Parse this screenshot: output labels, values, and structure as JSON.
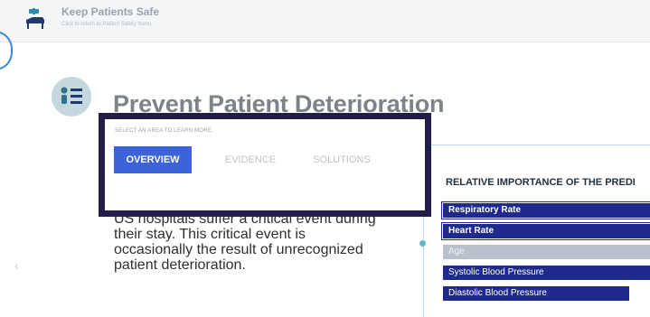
{
  "header": {
    "title": "Keep Patients Safe",
    "subtitle": "Click to return to Patient Safety menu."
  },
  "page": {
    "title": "Prevent Patient Deterioration",
    "body_text": "As many as 17% of patients admitted to US hospitals suffer a critical event during their stay. This critical event is occasionally the result of unrecognized patient deterioration."
  },
  "tabs": {
    "instruction": "SELECT AN AREA TO LEARN MORE.",
    "items": [
      {
        "label": "OVERVIEW",
        "active": true
      },
      {
        "label": "EVIDENCE",
        "active": false
      },
      {
        "label": "SOLUTIONS",
        "active": false
      }
    ]
  },
  "chart_data": {
    "type": "bar",
    "title": "RELATIVE IMPORTANCE OF THE PREDI",
    "categories": [
      "Respiratory Rate",
      "Heart Rate",
      "Age",
      "Systolic Blood Pressure",
      "Diastolic Blood Pressure"
    ],
    "values": [
      1.0,
      1.0,
      1.0,
      1.0,
      0.9
    ]
  },
  "colors": {
    "accent": "#3c63d9",
    "navy_bar": "#1e2a8c",
    "highlight_frame": "#221d4a",
    "age_bar": "#b9c2cc",
    "panel_line": "#b7dce6"
  },
  "icons": {
    "brand": "hospital-bed-icon",
    "topic": "patient-checklist-icon",
    "nav": "chevron-left-icon"
  }
}
